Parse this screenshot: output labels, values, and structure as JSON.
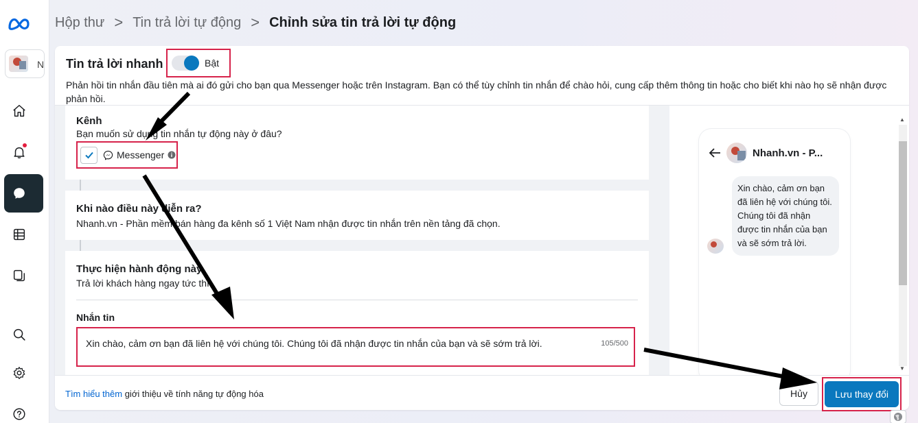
{
  "breadcrumb": {
    "items": [
      "Hộp thư",
      "Tin trả lời tự động",
      "Chỉnh sửa tin trả lời tự động"
    ],
    "separator": ">"
  },
  "account": {
    "initial": "N"
  },
  "nav": {
    "icons": [
      "meta-logo-icon",
      "home-icon",
      "bell-icon",
      "chat-icon",
      "table-icon",
      "pages-icon",
      "search-icon",
      "gear-icon",
      "help-icon"
    ],
    "active": "chat-icon"
  },
  "card": {
    "title": "Tin trả lời nhanh",
    "toggle_label": "Bật",
    "toggle_on": true,
    "description": "Phản hồi tin nhắn đầu tiên mà ai đó gửi cho bạn qua Messenger hoặc trên Instagram. Bạn có thể tùy chỉnh tin nhắn để chào hỏi, cung cấp thêm thông tin hoặc cho biết khi nào họ sẽ nhận được phản hồi."
  },
  "channel": {
    "title": "Kênh",
    "subtitle": "Bạn muốn sử dụng tin nhắn tự động này ở đâu?",
    "option_label": "Messenger",
    "checked": true
  },
  "trigger": {
    "title": "Khi nào điều này diễn ra?",
    "subtitle": "Nhanh.vn - Phần mềm bán hàng đa kênh số 1 Việt Nam nhận được tin nhắn trên nền tảng đã chọn."
  },
  "action": {
    "title": "Thực hiện hành động này",
    "subtitle": "Trả lời khách hàng ngay tức thì.",
    "message_label": "Nhắn tin",
    "message_value": "Xin chào, cảm ơn bạn đã liên hệ với chúng tôi. Chúng tôi đã nhận được tin nhắn của bạn và sẽ sớm trả lời.",
    "char_count": "105/500"
  },
  "preview": {
    "page_name": "Nhanh.vn - P...",
    "bubble_text": "Xin chào, cảm ơn bạn đã liên hệ với chúng tôi. Chúng tôi đã nhận được tin nhắn của bạn và sẽ sớm trả lời."
  },
  "footer": {
    "link_text": "Tìm hiểu thêm",
    "rest_text": " giới thiệu về tính năng tự động hóa",
    "cancel_label": "Hủy",
    "save_label": "Lưu thay đổi"
  },
  "colors": {
    "accent": "#0a78be",
    "highlight": "#d6224a",
    "link": "#0064d1"
  }
}
